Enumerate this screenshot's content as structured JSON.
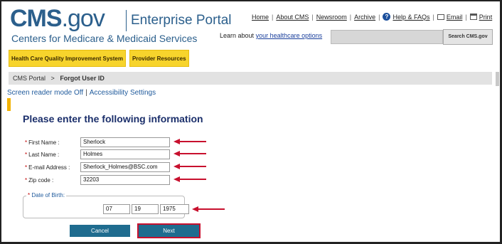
{
  "header": {
    "logo_main": "CMS",
    "logo_suffix": ".gov",
    "portal_title": "Enterprise Portal",
    "subtitle": "Centers for Medicare & Medicaid Services"
  },
  "toplinks": {
    "home": "Home",
    "about": "About CMS",
    "newsroom": "Newsroom",
    "archive": "Archive",
    "help": "Help & FAQs",
    "email": "Email",
    "print": "Print"
  },
  "learn": {
    "prefix": "Learn about",
    "link": "your healthcare options"
  },
  "search": {
    "value": "",
    "button_label": "Search CMS.gov"
  },
  "nav": {
    "tabs": [
      {
        "label": "Health Care Quality Improvement System"
      },
      {
        "label": "Provider Resources"
      }
    ]
  },
  "breadcrumb": {
    "root": "CMS Portal",
    "separator": ">",
    "current": "Forgot User ID"
  },
  "accessibility": {
    "screen_reader": "Screen reader mode Off",
    "separator": "|",
    "settings": "Accessibility Settings"
  },
  "form": {
    "heading": "Please enter the following information",
    "required_mark": "*",
    "first_name": {
      "label": "First Name :",
      "value": "Sherlock"
    },
    "last_name": {
      "label": "Last Name :",
      "value": "Holmes"
    },
    "email": {
      "label": "E-mail Address :",
      "value": "Sherlock_Holmes@BSC.com"
    },
    "zip": {
      "label": "Zip code :",
      "value": "32203"
    },
    "dob": {
      "legend": "Date of Birth:",
      "month": "07",
      "day": "19",
      "year": "1975"
    },
    "cancel_label": "Cancel",
    "next_label": "Next"
  },
  "colors": {
    "brand_blue": "#2b5f8c",
    "nav_yellow": "#f7d42c",
    "button_teal": "#1f6c8f",
    "annotation_red": "#c8102e"
  }
}
